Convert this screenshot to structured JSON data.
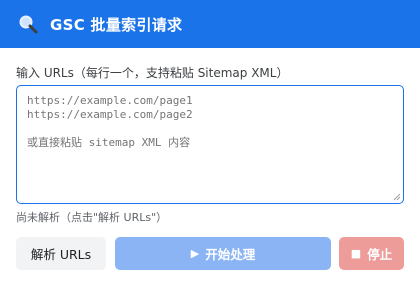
{
  "header": {
    "icon": "magnifier-icon",
    "title": "GSC 批量索引请求",
    "color": "#1a73e8"
  },
  "input": {
    "label": "输入 URLs（每行一个，支持粘贴 Sitemap XML）",
    "placeholder": "https://example.com/page1\nhttps://example.com/page2\n\n或直接粘贴 sitemap XML 内容"
  },
  "status_text": "尚未解析（点击\"解析 URLs\"）",
  "buttons": {
    "parse_label": "解析 URLs",
    "start_icon": "▶",
    "start_label": "开始处理",
    "stop_icon": "■",
    "stop_label": "停止"
  }
}
